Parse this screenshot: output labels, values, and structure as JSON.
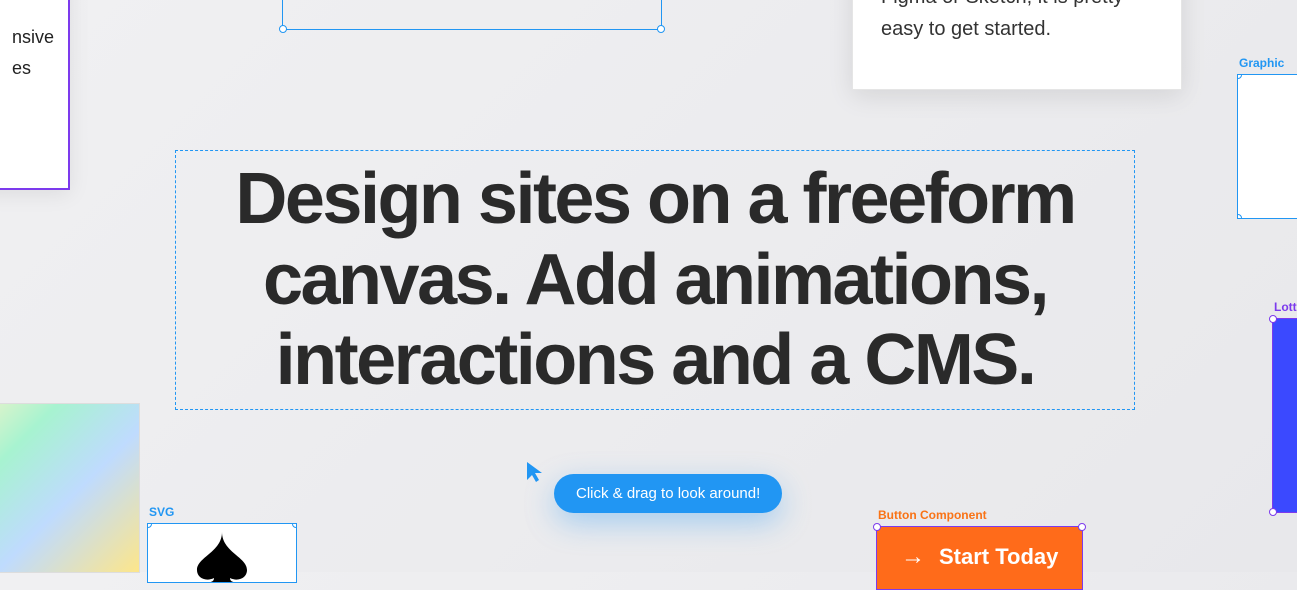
{
  "topleft_card": {
    "text": "nsive\nes"
  },
  "topright_card": {
    "text": "Figma or Sketch, it is pretty easy to get started."
  },
  "graphic": {
    "label": "Graphic"
  },
  "hero": {
    "heading": "Design sites on a freeform canvas. Add animations, interactions and a CMS."
  },
  "lottie": {
    "label": "Lottie"
  },
  "svg": {
    "label": "SVG"
  },
  "tooltip": {
    "text": "Click & drag to look around!"
  },
  "button_component": {
    "label": "Button Component",
    "text": "Start Today"
  }
}
